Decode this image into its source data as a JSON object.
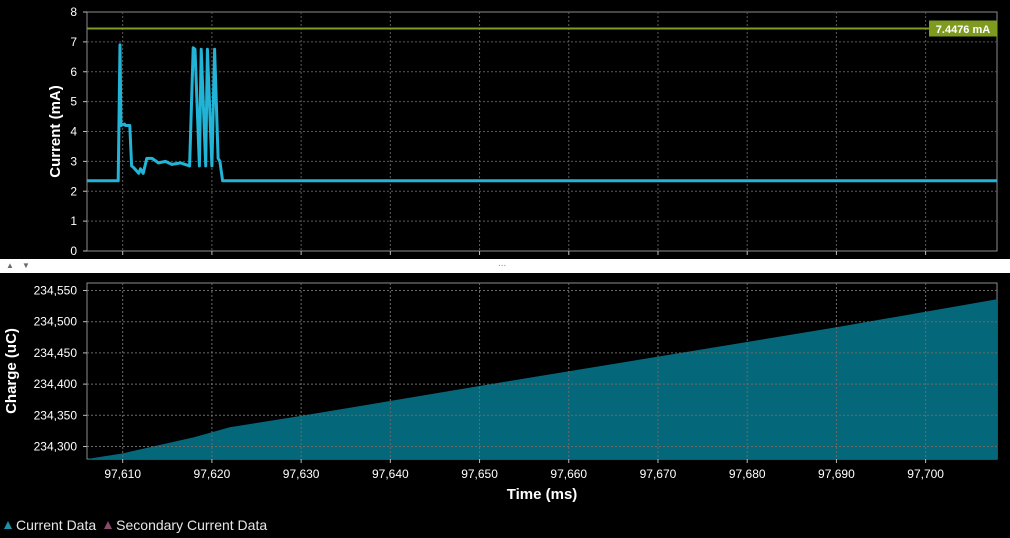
{
  "legend": {
    "items": [
      {
        "label": "Current Data",
        "color": "#1e8fa6"
      },
      {
        "label": "Secondary Current Data",
        "color": "#8a4a6a"
      }
    ]
  },
  "splitter": {
    "grip": "..."
  },
  "chart_data": [
    {
      "type": "line",
      "ylabel": "Current (mA)",
      "ylim": [
        0,
        8
      ],
      "yticks": [
        0,
        1,
        2,
        3,
        4,
        5,
        6,
        7,
        8
      ],
      "xlim": [
        97606,
        97708
      ],
      "grid": true,
      "line_color": "#22b4d6",
      "marker": {
        "value": 7.4476,
        "label": "7.4476 mA",
        "color": "#7f9b1f"
      },
      "series": [
        {
          "x": [
            97606,
            97609.5,
            97609.7,
            97609.8,
            97610.2,
            97610.3,
            97610.8,
            97611,
            97611.2,
            97611.5,
            97611.8,
            97612,
            97612.3,
            97612.7,
            97613.3,
            97614,
            97614.8,
            97615.5,
            97616.5,
            97617.5,
            97617.9,
            97618.1,
            97618.6,
            97618.8,
            97619.3,
            97619.5,
            97620,
            97620.3,
            97620.7,
            97620.9,
            97621.2,
            97621.5,
            97621.8,
            97622,
            97630,
            97650,
            97670,
            97690,
            97708
          ],
          "y": [
            2.35,
            2.35,
            6.9,
            4.2,
            4.25,
            4.2,
            4.2,
            2.85,
            2.8,
            2.7,
            2.6,
            2.75,
            2.6,
            3.1,
            3.1,
            2.95,
            3.0,
            2.9,
            2.95,
            2.85,
            6.8,
            6.75,
            2.85,
            6.75,
            2.85,
            6.75,
            2.85,
            6.75,
            3.1,
            3.0,
            2.35,
            2.35,
            2.35,
            2.35,
            2.35,
            2.35,
            2.35,
            2.35,
            2.35
          ]
        }
      ]
    },
    {
      "type": "area",
      "ylabel": "Charge (uC)",
      "xlabel": "Time (ms)",
      "ylim": [
        234280,
        234562
      ],
      "yticks": [
        234300,
        234350,
        234400,
        234450,
        234500,
        234550
      ],
      "ytick_labels": [
        "234,300",
        "234,350",
        "234,400",
        "234,450",
        "234,500",
        "234,550"
      ],
      "xlim": [
        97606,
        97708
      ],
      "xticks": [
        97610,
        97620,
        97630,
        97640,
        97650,
        97660,
        97670,
        97680,
        97690,
        97700
      ],
      "xtick_labels": [
        "97,610",
        "97,620",
        "97,630",
        "97,640",
        "97,650",
        "97,660",
        "97,670",
        "97,680",
        "97,690",
        "97,700"
      ],
      "grid": true,
      "fill_color": "#05677a",
      "series": [
        {
          "x": [
            97606,
            97610,
            97614,
            97618,
            97620,
            97622,
            97630,
            97650,
            97670,
            97690,
            97708
          ],
          "y": [
            234280,
            234289,
            234302,
            234315,
            234323,
            234331,
            234349,
            234397,
            234444,
            234491,
            234536
          ]
        }
      ]
    }
  ]
}
